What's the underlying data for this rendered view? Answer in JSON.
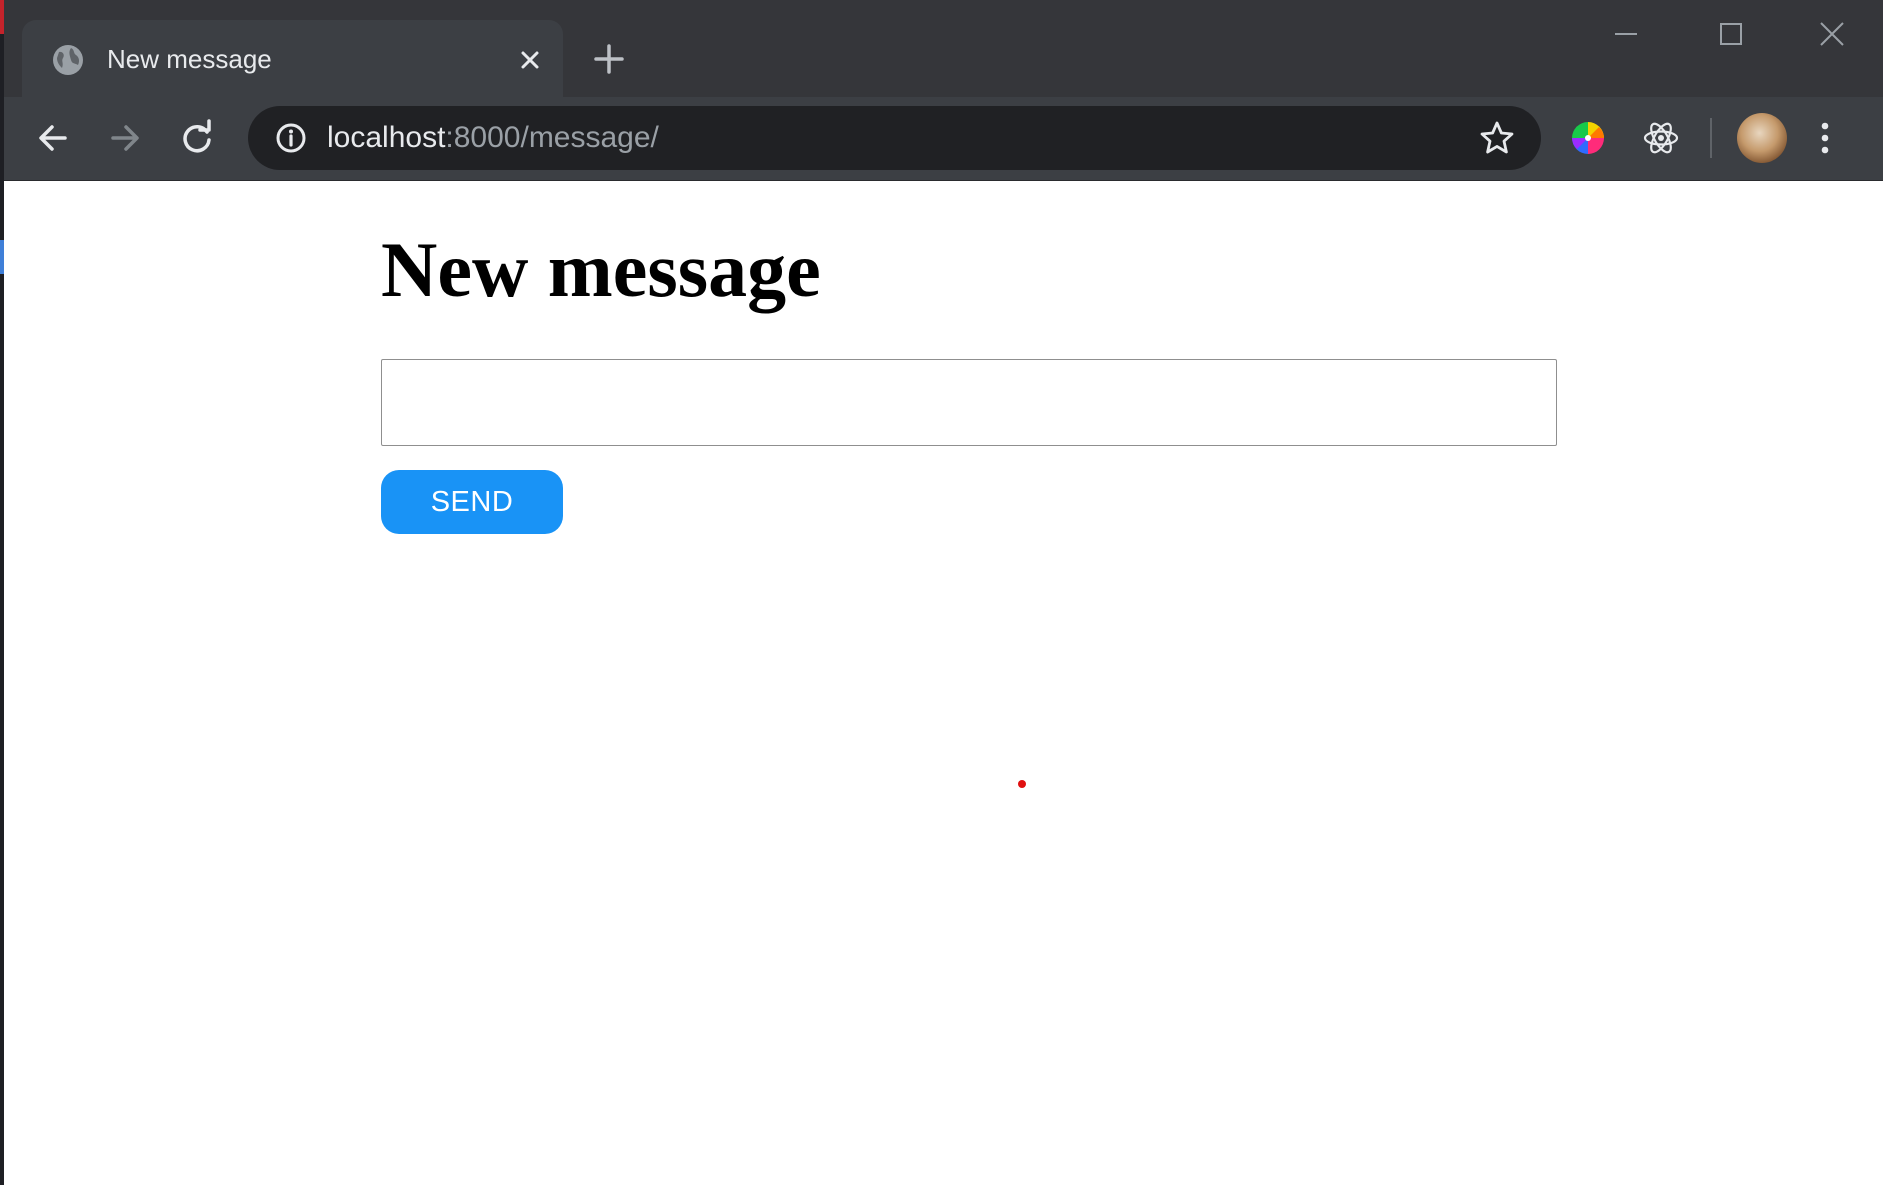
{
  "browser": {
    "tab": {
      "title": "New message",
      "favicon_icon": "globe-icon",
      "close_icon": "close-icon"
    },
    "new_tab_icon": "plus-icon",
    "window_controls": [
      "minimize-icon",
      "maximize-icon",
      "close-icon"
    ],
    "toolbar": {
      "back_icon": "arrow-left-icon",
      "forward_icon": "arrow-right-icon",
      "reload_icon": "reload-icon",
      "site_info_icon": "info-icon",
      "url_host": "localhost",
      "url_rest": ":8000/message/",
      "bookmark_icon": "star-icon",
      "extensions": [
        "color-wheel-icon",
        "react-atom-icon"
      ],
      "avatar_icon": "profile-avatar",
      "menu_icon": "kebab-menu-icon"
    }
  },
  "page": {
    "heading": "New message",
    "message_input": {
      "value": "",
      "placeholder": ""
    },
    "send_label": "SEND"
  },
  "colors": {
    "send_button": "#1993f6",
    "titlebar": "#35363a",
    "toolbar": "#3c3f44",
    "omnibox": "#202124",
    "cursor_dot": "#e01010"
  }
}
